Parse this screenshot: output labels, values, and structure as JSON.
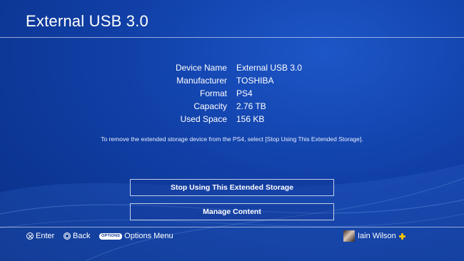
{
  "header": {
    "title": "External USB 3.0"
  },
  "device_info": [
    {
      "label": "Device Name",
      "value": "External USB 3.0"
    },
    {
      "label": "Manufacturer",
      "value": "TOSHIBA"
    },
    {
      "label": "Format",
      "value": "PS4"
    },
    {
      "label": "Capacity",
      "value": "2.76 TB"
    },
    {
      "label": "Used Space",
      "value": "156 KB"
    }
  ],
  "note": "To remove the extended storage device from the PS4, select [Stop Using This Extended Storage].",
  "buttons": {
    "stop_label": "Stop Using This Extended Storage",
    "manage_label": "Manage Content"
  },
  "footer": {
    "enter_label": "Enter",
    "back_label": "Back",
    "options_badge": "OPTIONS",
    "options_label": "Options Menu",
    "user_name": "Iain Wilson"
  },
  "icons": {
    "enter": "cross-button-icon",
    "back": "circle-button-icon",
    "options": "options-button-icon",
    "plus": "playstation-plus-icon",
    "avatar": "user-avatar"
  },
  "colors": {
    "background": "#103fa6",
    "plus_icon": "#f5c400",
    "text": "#ffffff"
  }
}
